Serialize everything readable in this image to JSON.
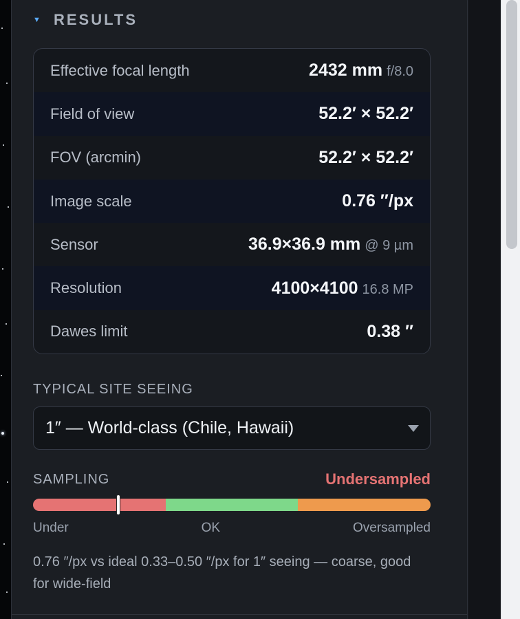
{
  "results": {
    "title": "RESULTS",
    "rows": [
      {
        "label": "Effective focal length",
        "value": "2432 mm",
        "extra": "f/8.0"
      },
      {
        "label": "Field of view",
        "value": "52.2′ × 52.2′",
        "extra": ""
      },
      {
        "label": "FOV (arcmin)",
        "value": "52.2′ × 52.2′",
        "extra": ""
      },
      {
        "label": "Image scale",
        "value": "0.76 ″/px",
        "extra": ""
      },
      {
        "label": "Sensor",
        "value": "36.9×36.9 mm",
        "extra": "@ 9 µm"
      },
      {
        "label": "Resolution",
        "value": "4100×4100",
        "extra": "16.8 MP"
      },
      {
        "label": "Dawes limit",
        "value": "0.38 ″",
        "extra": ""
      }
    ]
  },
  "seeing": {
    "label": "TYPICAL SITE SEEING",
    "selected": "1″ — World-class (Chile, Hawaii)"
  },
  "sampling": {
    "label": "SAMPLING",
    "status": "Undersampled",
    "status_color": "#e57373",
    "marker_fraction": 0.215,
    "segments": [
      {
        "key": "under",
        "color": "#e57373"
      },
      {
        "key": "ok",
        "color": "#7ed88a"
      },
      {
        "key": "over",
        "color": "#ee9a4d"
      }
    ],
    "scale_labels": {
      "under": "Under",
      "ok": "OK",
      "over": "Oversampled"
    },
    "note": "0.76 ″/px vs ideal 0.33–0.50 ″/px for 1″ seeing — coarse, good for wide-field"
  }
}
